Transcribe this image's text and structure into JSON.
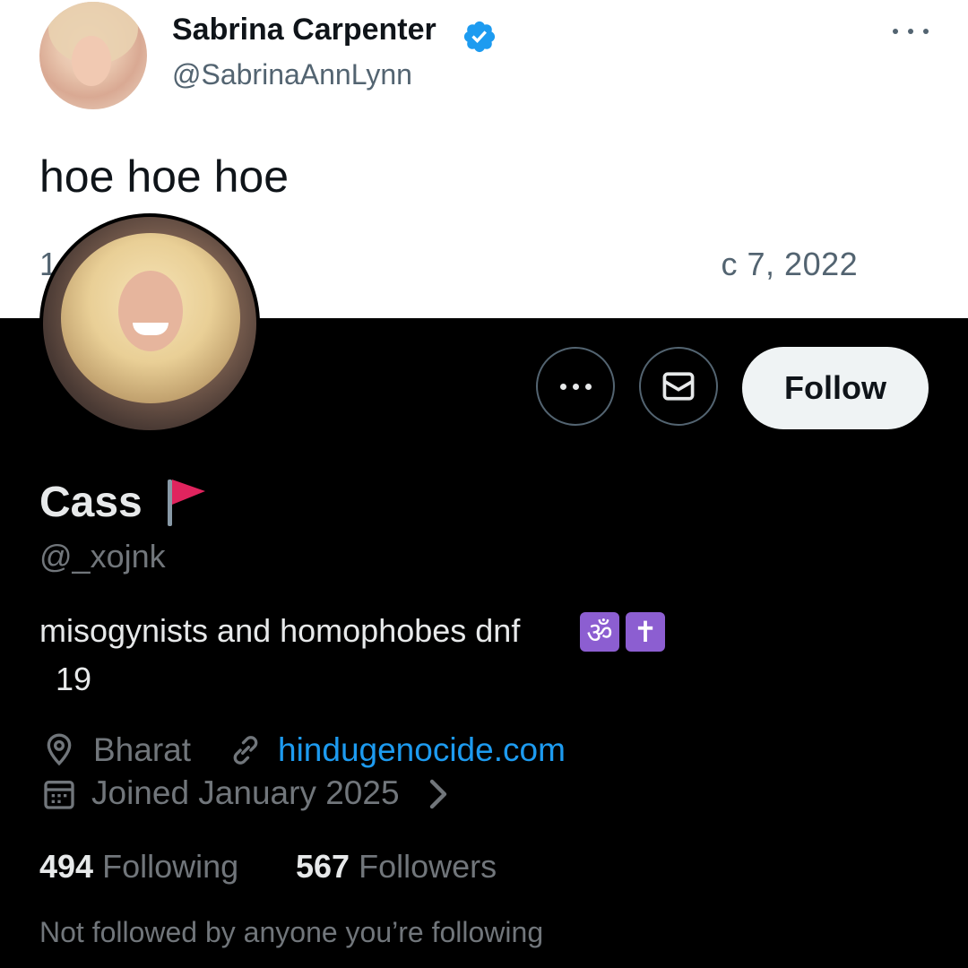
{
  "tweet": {
    "author_name": "Sabrina Carpenter",
    "author_handle": "@SabrinaAnnLynn",
    "text": "hoe hoe hoe",
    "timestamp_visible": "1                                        c 7, 2022",
    "icons": {
      "verified": "verified-badge-icon",
      "more": "more-dots-icon"
    }
  },
  "profile": {
    "display_name": "Cass",
    "name_emoji": "red-flag-icon",
    "handle": "@_xojnk",
    "bio": "misogynists and homophobes dnf",
    "bio_emojis": [
      "ॐ",
      "✝"
    ],
    "bio_age": "19",
    "location": "Bharat",
    "website": "hindugenocide.com",
    "joined": "Joined January 2025",
    "following_count": "494",
    "following_label": " Following",
    "followers_count": "567",
    "followers_label": " Followers",
    "followed_by_note": "Not followed by anyone you’re following"
  },
  "actions": {
    "more_icon": "more-dots-icon",
    "message_icon": "envelope-icon",
    "follow_label": "Follow"
  },
  "colors": {
    "background": "#000000",
    "primary_text": "#e7e9ea",
    "secondary_text": "#71767b",
    "link": "#1d9bf0",
    "verified": "#1d9bf0",
    "flag": "#e0245e",
    "emoji_box": "#8c5ed1"
  }
}
